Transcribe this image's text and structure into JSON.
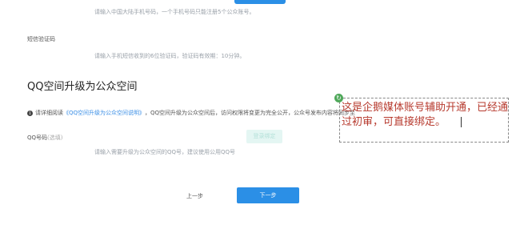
{
  "phone": {
    "hint": "请输入中国大陆手机号码，一个手机号码只能注册5个公众账号。"
  },
  "sms": {
    "label": "短信验证码",
    "hint": "请输入手机短信收到的6位验证码，验证码有效期：10分钟。"
  },
  "qq_space": {
    "title": "QQ空间升级为公众空间",
    "info_prefix": "请详细阅读",
    "info_link": "《QQ空间升级为公众空间说明》",
    "info_suffix": "，QQ空间升级为公众空间后，访问权限将变更为完全公开，公众号发布内容将同步至",
    "qq_label": "QQ号码",
    "qq_optional": "(选填)",
    "bind_label": "登录绑定",
    "qq_hint": "请输入需要升级为公众空间的QQ号，建议使用公用QQ号"
  },
  "footer": {
    "prev_label": "上一步",
    "next_label": "下一步"
  },
  "annotation": {
    "text": "这是企鹅媒体账号辅助开通，已经通过初审，可直接绑定。"
  },
  "colors": {
    "primary": "#2b8fe6",
    "annotation": "#b73a2e",
    "bind_bg": "#e4f6f3"
  }
}
